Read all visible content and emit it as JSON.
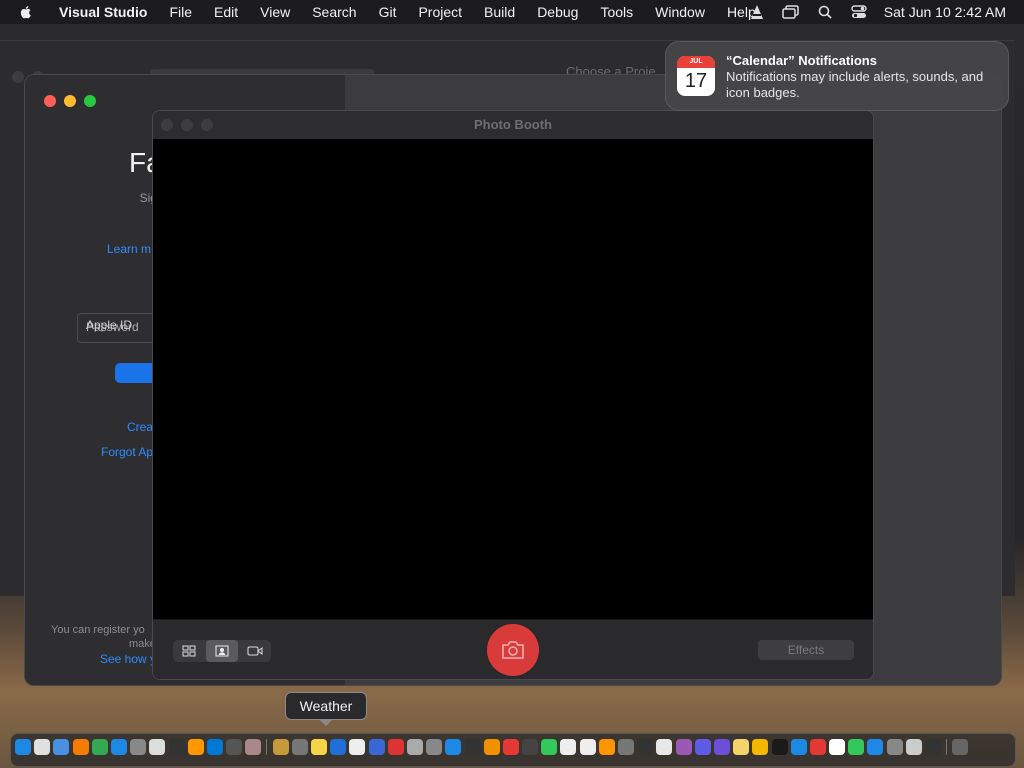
{
  "menubar": {
    "apple_icon": "apple-logo-icon",
    "items": [
      "Visual Studio",
      "File",
      "Edit",
      "View",
      "Search",
      "Git",
      "Project",
      "Build",
      "Debug",
      "Tools",
      "Window",
      "Help"
    ],
    "clock": "Sat Jun 10  2:42 AM",
    "status_icons": [
      "vlc-icon",
      "screen-mirroring-icon",
      "search-icon",
      "control-center-icon"
    ]
  },
  "background_window": {
    "title_fragment": "Choose a Proje"
  },
  "signin": {
    "title": "Fa",
    "desc": "Sign in with\nacti",
    "learn": "Learn m",
    "field_label_1": "Apple ID",
    "field_label_2": "Password",
    "create": "Crea",
    "forgot": "Forgot Ap",
    "footer_line1": "You can register yo",
    "footer_line2": "make",
    "see_how": "See how y"
  },
  "photobooth": {
    "title": "Photo Booth",
    "effects_label": "Effects",
    "modes": [
      "grid-view-icon",
      "single-photo-icon",
      "video-icon"
    ],
    "active_mode": 1
  },
  "notification": {
    "cal_month": "JUL",
    "cal_day": "17",
    "heading": "“Calendar” Notifications",
    "body": "Notifications may include alerts, sounds, and icon badges."
  },
  "tooltip": {
    "label": "Weather"
  },
  "dock": {
    "icon_colors": [
      "#1e88e5",
      "#e0e0e0",
      "#4a90e2",
      "#f57c00",
      "#34a853",
      "#1e88e5",
      "#888",
      "#ddd",
      "#333",
      "#ff9800",
      "#0078d4",
      "#555",
      "#a88",
      "#c49a3a",
      "#777",
      "#f5d547",
      "#1e6fd9",
      "#eee",
      "#3867d6",
      "#d33",
      "#aaa",
      "#888",
      "#1e88e5",
      "#333",
      "#f29100",
      "#e53935",
      "#444",
      "#34c759",
      "#eee",
      "#eee",
      "#ff9500",
      "#777",
      "#333",
      "#e8e8e8",
      "#9b59b6",
      "#5e5ce6",
      "#6c4ed9",
      "#f3d36b",
      "#f5b700",
      "#1a1a1a",
      "#1e88e5",
      "#e53935",
      "#fff",
      "#34c759",
      "#1e88e5",
      "#888",
      "#ccc",
      "#333",
      "#666"
    ]
  }
}
